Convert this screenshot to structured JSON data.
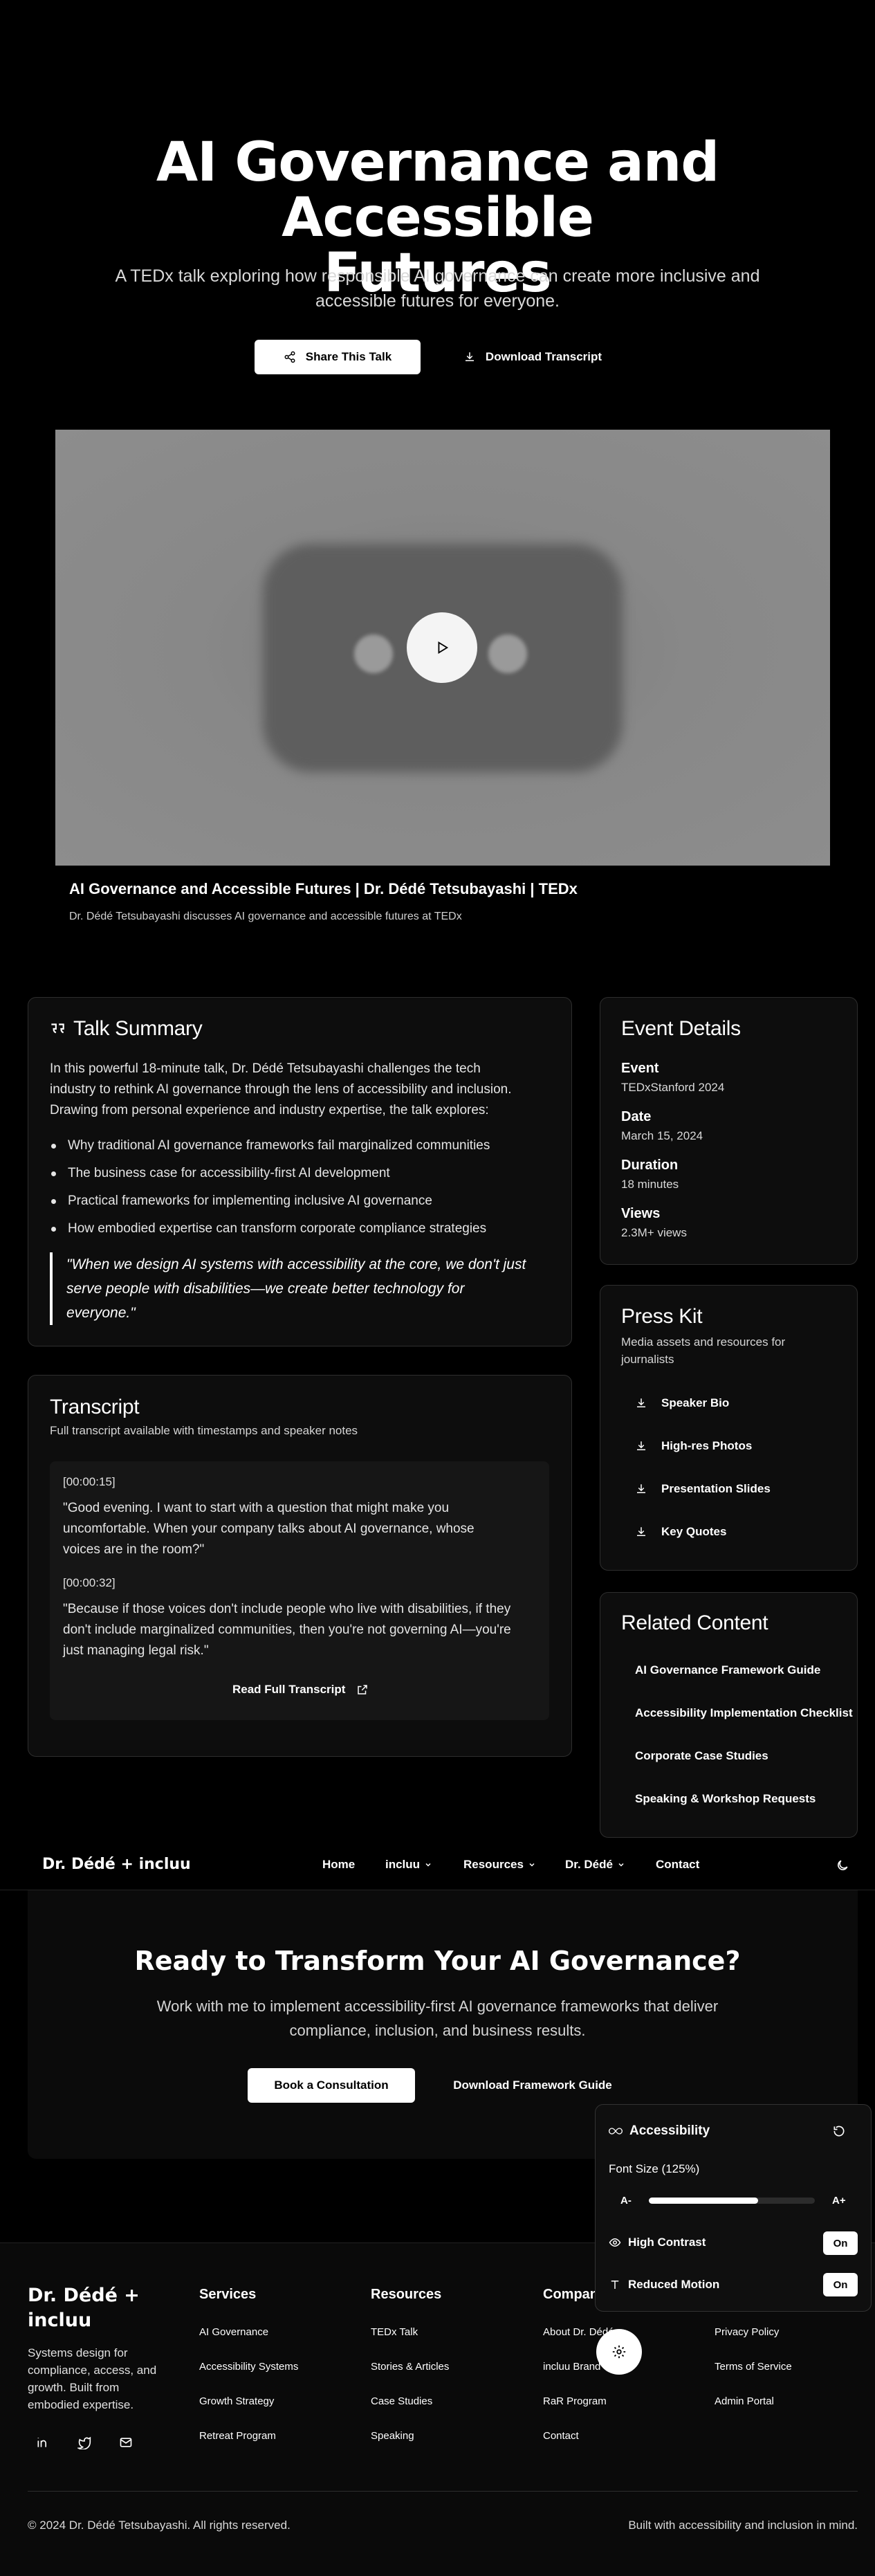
{
  "hero": {
    "title_line1": "AI Governance and Accessible",
    "title_line2": "Futures",
    "subtitle_line1": "A TEDx talk exploring how responsible AI governance can create more inclusive and",
    "subtitle_line2": "accessible futures for everyone.",
    "share_label": "Share This Talk",
    "download_label": "Download Transcript",
    "share_icon": "share-icon",
    "download_icon": "download-icon"
  },
  "video": {
    "title": "AI Governance and Accessible Futures | Dr. Dédé Tetsubayashi | TEDx",
    "caption": "Dr. Dédé Tetsubayashi discusses AI governance and accessible futures at TEDx",
    "play_icon": "play-icon"
  },
  "summary": {
    "heading": "Talk Summary",
    "icon": "quote-icon",
    "intro_lines": [
      "In this powerful 18-minute talk, Dr. Dédé Tetsubayashi challenges the tech",
      "industry to rethink AI governance through the lens of accessibility and inclusion.",
      "Drawing from personal experience and industry expertise, the talk explores:"
    ],
    "bullets": [
      "Why traditional AI governance frameworks fail marginalized communities",
      "The business case for accessibility-first AI development",
      "Practical frameworks for implementing inclusive AI governance",
      "How embodied expertise can transform corporate compliance strategies"
    ],
    "quote_lines": [
      "\"When we design AI systems with accessibility at the core, we don't just",
      "serve people with disabilities—we create better technology for",
      "everyone.\""
    ]
  },
  "transcript": {
    "heading": "Transcript",
    "subheading": "Full transcript available with timestamps and speaker notes",
    "entries": [
      {
        "time": "[00:00:15]",
        "lines": [
          "\"Good evening. I want to start with a question that might make you",
          "uncomfortable. When your company talks about AI governance, whose",
          "voices are in the room?\""
        ]
      },
      {
        "time": "[00:00:32]",
        "lines": [
          "\"Because if those voices don't include people who live with disabilities, if they",
          "don't include marginalized communities, then you're not governing AI—you're",
          "just managing legal risk.\""
        ]
      }
    ],
    "read_full_label": "Read Full Transcript",
    "read_full_icon": "external-link-icon"
  },
  "event": {
    "heading": "Event Details",
    "items": [
      {
        "label": "Event",
        "value": "TEDxStanford 2024"
      },
      {
        "label": "Date",
        "value": "March 15, 2024"
      },
      {
        "label": "Duration",
        "value": "18 minutes"
      },
      {
        "label": "Views",
        "value": "2.3M+ views"
      }
    ]
  },
  "press_kit": {
    "heading": "Press Kit",
    "subheading_line1": "Media assets and resources for",
    "subheading_line2": "journalists",
    "items": [
      "Speaker Bio",
      "High-res Photos",
      "Presentation Slides",
      "Key Quotes"
    ],
    "item_icon": "download-icon"
  },
  "related": {
    "heading": "Related Content",
    "items": [
      "AI Governance Framework Guide",
      "Accessibility Implementation Checklist",
      "Corporate Case Studies",
      "Speaking & Workshop Requests"
    ]
  },
  "nav": {
    "brand": "Dr. Dédé + incluu",
    "items": [
      {
        "label": "Home",
        "dropdown": false
      },
      {
        "label": "incluu",
        "dropdown": true
      },
      {
        "label": "Resources",
        "dropdown": true
      },
      {
        "label": "Dr. Dédé",
        "dropdown": true
      },
      {
        "label": "Contact",
        "dropdown": false
      }
    ],
    "theme_icon": "moon-icon"
  },
  "cta": {
    "title": "Ready to Transform Your AI Governance?",
    "subtitle_line1": "Work with me to implement accessibility-first AI governance frameworks that deliver",
    "subtitle_line2": "compliance, inclusion, and business results.",
    "primary_label": "Book a Consultation",
    "secondary_label": "Download Framework Guide"
  },
  "accessibility_panel": {
    "title": "Accessibility",
    "title_icon": "infinity-icon",
    "reset_icon": "reset-icon",
    "font_size_label": "Font Size (125%)",
    "font_size_percent": 125,
    "slider_fill_fraction": 0.66,
    "decrease_label": "A-",
    "increase_label": "A+",
    "high_contrast_label": "High Contrast",
    "high_contrast_state": "On",
    "high_contrast_icon": "eye-icon",
    "reduced_motion_label": "Reduced Motion",
    "reduced_motion_state": "On",
    "reduced_motion_icon": "text-icon",
    "fab_icon": "settings-icon"
  },
  "footer": {
    "brand_line1": "Dr. Dédé +",
    "brand_line2": "incluu",
    "tagline_lines": [
      "Systems design for",
      "compliance, access, and",
      "growth. Built from",
      "embodied expertise."
    ],
    "social_icons": [
      "linkedin-icon",
      "twitter-icon",
      "mail-icon"
    ],
    "columns": [
      {
        "heading": "Services",
        "links": [
          "AI Governance",
          "Accessibility Systems",
          "Growth Strategy",
          "Retreat Program"
        ]
      },
      {
        "heading": "Resources",
        "links": [
          "TEDx Talk",
          "Stories & Articles",
          "Case Studies",
          "Speaking"
        ]
      },
      {
        "heading": "Company",
        "links": [
          "About Dr. Dédé",
          "incluu Brand",
          "RaR Program",
          "Contact"
        ]
      },
      {
        "heading": "",
        "links": [
          "Privacy Policy",
          "Terms of Service",
          "Admin Portal"
        ]
      }
    ],
    "copyright": "© 2024 Dr. Dédé Tetsubayashi. All rights reserved.",
    "built_with": "Built with accessibility and inclusion in mind."
  },
  "colors": {
    "background": "#000000",
    "card": "#0d0d0d",
    "border": "#2e2e2e",
    "accent": "#ffffff"
  }
}
